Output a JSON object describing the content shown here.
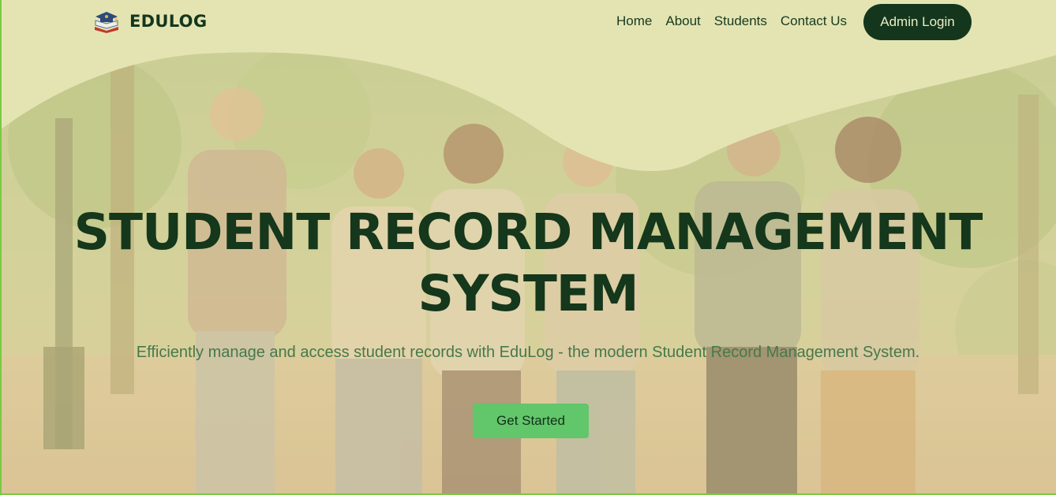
{
  "brand": {
    "name": "EDULOG",
    "logo_icon": "book-graduation-icon"
  },
  "nav": {
    "links": [
      "Home",
      "About",
      "Students",
      "Contact Us"
    ],
    "admin_button": "Admin Login"
  },
  "hero": {
    "title_line1": "STUDENT RECORD MANAGEMENT",
    "title_line2": "SYSTEM",
    "subtitle": "Efficiently manage and access student records with EduLog - the modern Student Record Management System.",
    "cta_label": "Get Started",
    "background_image": "students-walking-in-park-photo"
  },
  "colors": {
    "page_bg": "#e4e4b3",
    "primary_dark": "#14361c",
    "accent_green": "#62c66a",
    "subtitle_green": "#47784a",
    "frame_green": "#7ac943"
  }
}
